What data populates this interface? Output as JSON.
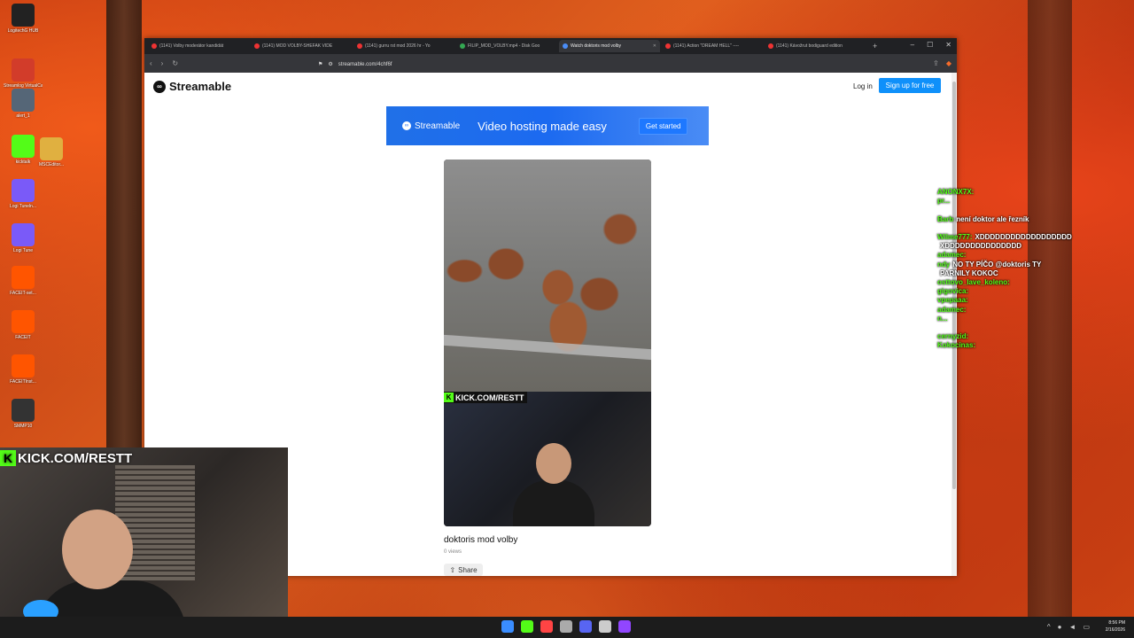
{
  "desktop": {
    "icons": [
      {
        "label": "LogitechG HUB",
        "color": "#222222"
      },
      {
        "label": "Streamlog VirtualCam",
        "color": "#d23c2a"
      },
      {
        "label": "alert_1",
        "color": "#556677"
      },
      {
        "label": "kicktalk",
        "color": "#53fc18"
      },
      {
        "label": "Logi Tuneln...",
        "color": "#7a5af8"
      },
      {
        "label": "Logi Tune",
        "color": "#7a5af8"
      },
      {
        "label": "FACEIT-set...",
        "color": "#ff5500"
      },
      {
        "label": "FACEIT",
        "color": "#ff5500"
      },
      {
        "label": "FACEITInst...",
        "color": "#ff5500"
      },
      {
        "label": "SMMP10",
        "color": "#333333"
      }
    ],
    "icon_extra": {
      "label": "MSCEditor...",
      "color": "#e0b040"
    }
  },
  "browser": {
    "tabs": [
      {
        "title": "(1141) Volby moderátor kandidát",
        "fav": "red"
      },
      {
        "title": "(1141) MOD VOLBY-SHEFAK VIDE",
        "fav": "red"
      },
      {
        "title": "(1141) gurru rst mod 2026 hr - Yo",
        "fav": "red"
      },
      {
        "title": "FILIP_MOD_VOLBY.mp4 - Disk Goo",
        "fav": "green"
      },
      {
        "title": "Watch doktoris mod volby",
        "fav": "blue",
        "active": true
      },
      {
        "title": "(1141) Action \"DREAM HELL\" ----",
        "fav": "red"
      },
      {
        "title": "(1141) Kávožrut bodiguard edition",
        "fav": "red"
      }
    ],
    "new_tab": "+",
    "url": "streamable.com/4chf6f"
  },
  "page": {
    "logo_text": "Streamable",
    "login": "Log in",
    "signup": "Sign up for free",
    "banner": {
      "logo_text": "Streamable",
      "tagline": "Video hosting made easy",
      "cta": "Get started"
    },
    "video": {
      "overlay_top": "KICK.COM/RESTT",
      "title": "doktoris mod volby",
      "views": "0 views",
      "share": "Share"
    }
  },
  "chat": [
    {
      "user": "ANONX7X:",
      "msg": ""
    },
    {
      "user": "pr...",
      "msg": ""
    },
    {
      "user": "",
      "msg": ""
    },
    {
      "user": "Barb",
      "msg": "není doktor ale řezník"
    },
    {
      "user": "",
      "msg": ""
    },
    {
      "user": "Wilme777:",
      "msg": "XDDDDDDDDDDDDDDDDDD"
    },
    {
      "user": "",
      "msg": "XDDDDDDDDDDDDDDD"
    },
    {
      "user": "adamec:",
      "msg": ""
    },
    {
      "user": "ndy",
      "msg": "NO TY PÍČO @doktoris TY"
    },
    {
      "user": "",
      "msg": "PARNILY KOKOC"
    },
    {
      "user": "osttovo_lave_koleno:",
      "msg": ""
    },
    {
      "user": "gigovica:",
      "msg": ""
    },
    {
      "user": "vpepaaa:",
      "msg": ""
    },
    {
      "user": "adamec:",
      "msg": ""
    },
    {
      "user": "n...",
      "msg": ""
    },
    {
      "user": "",
      "msg": ""
    },
    {
      "user": "cernyzid:",
      "msg": ""
    },
    {
      "user": "Kokocinas:",
      "msg": ""
    }
  ],
  "webcam": {
    "overlay": "KICK.COM/RESTT"
  },
  "taskbar": {
    "time": "8:56 PM",
    "date": "2/16/2026",
    "icon_colors": [
      "#3a8dff",
      "#53fc18",
      "#ff4444",
      "#aaaaaa",
      "#5865f2",
      "#cccccc",
      "#9146ff"
    ]
  }
}
